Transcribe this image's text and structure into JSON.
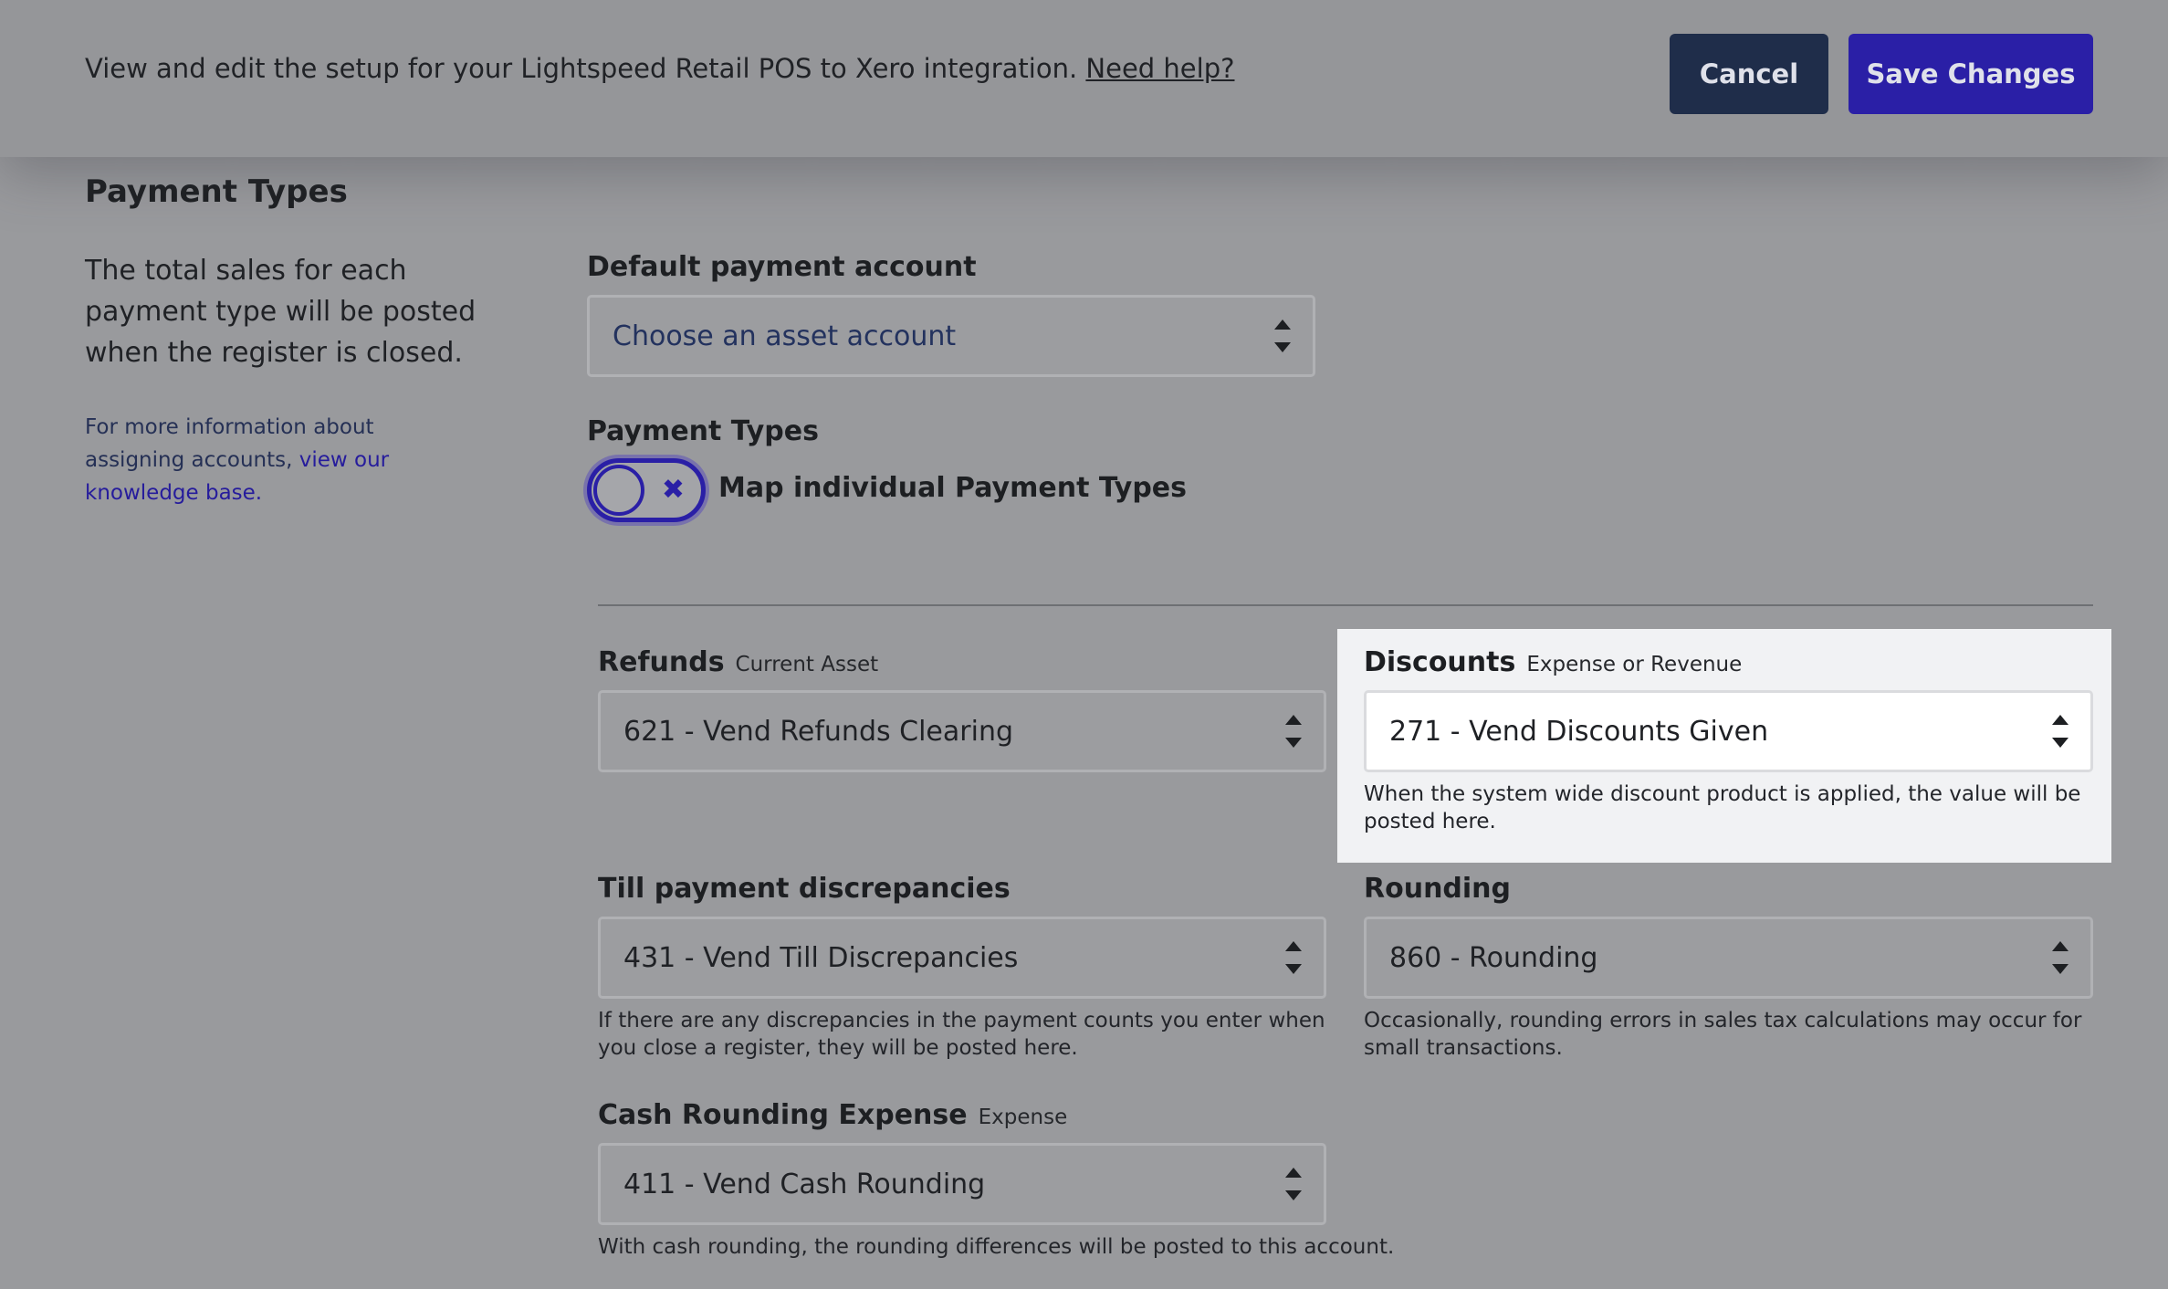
{
  "header": {
    "description": "View and edit the setup for your Lightspeed Retail POS to Xero integration.",
    "help_link": "Need help?",
    "cancel_label": "Cancel",
    "save_label": "Save Changes"
  },
  "section": {
    "title": "Payment Types",
    "intro": "The total sales for each payment type will be posted when the register is closed.",
    "more_info_prefix": "For more information about assigning accounts,",
    "more_info_link": "view our knowledge base."
  },
  "default_payment": {
    "label": "Default payment account",
    "placeholder": "Choose an asset account"
  },
  "payment_types": {
    "label": "Payment Types",
    "toggle_label": "Map individual Payment Types",
    "toggle_on": false
  },
  "refunds": {
    "label": "Refunds",
    "sublabel": "Current Asset",
    "value": "621 - Vend Refunds Clearing"
  },
  "discounts": {
    "label": "Discounts",
    "sublabel": "Expense or Revenue",
    "value": "271 - Vend Discounts Given",
    "help": "When the system wide discount product is applied, the value will be posted here."
  },
  "till": {
    "label": "Till payment discrepancies",
    "value": "431 - Vend Till Discrepancies",
    "help": "If there are any discrepancies in the payment counts you enter when you close a register, they will be posted here."
  },
  "rounding": {
    "label": "Rounding",
    "value": "860 - Rounding",
    "help": "Occasionally, rounding errors in sales tax calculations may occur for small transactions."
  },
  "cash_rounding": {
    "label": "Cash Rounding Expense",
    "sublabel": "Expense",
    "value": "411 - Vend Cash Rounding",
    "help": "With cash rounding, the rounding differences will be posted to this account."
  },
  "colors": {
    "primary": "#2a1fa6",
    "cancel": "#1f2d4a",
    "highlight_bg": "#f1f2f4"
  }
}
